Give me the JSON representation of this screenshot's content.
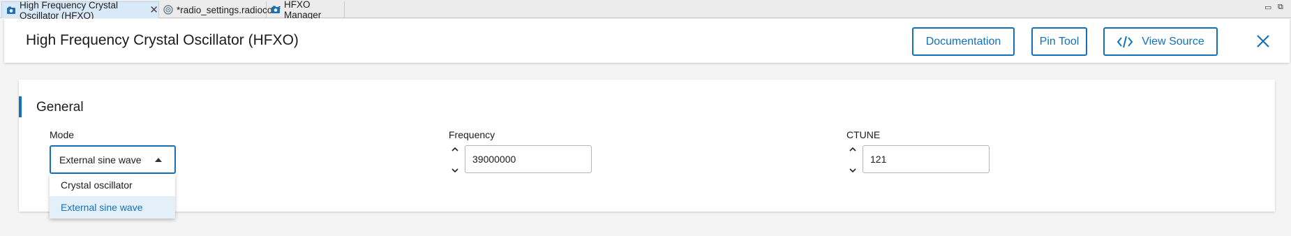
{
  "tabs": [
    {
      "label": "High Frequency Crystal Oscillator (HFXO)",
      "active": true,
      "icon": "config-icon"
    },
    {
      "label": "*radio_settings.radioconf",
      "active": false,
      "icon": "radio-icon"
    },
    {
      "label": "HFXO Manager",
      "active": false,
      "icon": "config-icon"
    }
  ],
  "header": {
    "title": "High Frequency Crystal Oscillator (HFXO)",
    "documentation_label": "Documentation",
    "pin_tool_label": "Pin Tool",
    "view_source_label": "View Source"
  },
  "general": {
    "title": "General",
    "mode": {
      "label": "Mode",
      "value": "External sine wave",
      "options": [
        "Crystal oscillator",
        "External sine wave"
      ],
      "selected_index": 1
    },
    "frequency": {
      "label": "Frequency",
      "value": "39000000"
    },
    "ctune": {
      "label": "CTUNE",
      "value": "121"
    }
  },
  "colors": {
    "accent": "#1470b8",
    "selected_bg": "#e3eff9"
  }
}
